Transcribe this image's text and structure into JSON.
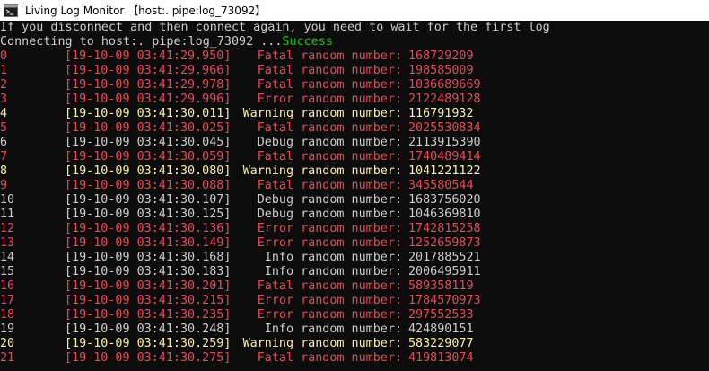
{
  "window": {
    "title": "Living Log Monitor  【host:. pipe:log_73092】"
  },
  "console": {
    "notice": "If you disconnect and then connect again, you need to wait for the first log",
    "connecting": "Connecting to host:. pipe:log_73092 ...",
    "success": "Success"
  },
  "colors": {
    "fatal": "#e74856",
    "error": "#e74856",
    "warning": "#f9f1a5",
    "debug": "#cccccc",
    "info": "#cccccc",
    "success": "#16c60c",
    "background": "#0c0c0c"
  },
  "logs": [
    {
      "index": "0",
      "time": "[19-10-09 03:41:29.950]",
      "level": "Fatal",
      "text": "Fatal random number:",
      "number": "168729209"
    },
    {
      "index": "1",
      "time": "[19-10-09 03:41:29.966]",
      "level": "Fatal",
      "text": "Fatal random number:",
      "number": "198585009"
    },
    {
      "index": "2",
      "time": "[19-10-09 03:41:29.978]",
      "level": "Fatal",
      "text": "Fatal random number:",
      "number": "1036689669"
    },
    {
      "index": "3",
      "time": "[19-10-09 03:41:29.996]",
      "level": "Error",
      "text": "Error random number:",
      "number": "2122489128"
    },
    {
      "index": "4",
      "time": "[19-10-09 03:41:30.011]",
      "level": "Warning",
      "text": "Warning random number:",
      "number": "116791932"
    },
    {
      "index": "5",
      "time": "[19-10-09 03:41:30.025]",
      "level": "Fatal",
      "text": "Fatal random number:",
      "number": "2025530834"
    },
    {
      "index": "6",
      "time": "[19-10-09 03:41:30.045]",
      "level": "Debug",
      "text": "Debug random number:",
      "number": "2113915390"
    },
    {
      "index": "7",
      "time": "[19-10-09 03:41:30.059]",
      "level": "Fatal",
      "text": "Fatal random number:",
      "number": "1740489414"
    },
    {
      "index": "8",
      "time": "[19-10-09 03:41:30.080]",
      "level": "Warning",
      "text": "Warning random number:",
      "number": "1041221122"
    },
    {
      "index": "9",
      "time": "[19-10-09 03:41:30.088]",
      "level": "Fatal",
      "text": "Fatal random number:",
      "number": "345580544"
    },
    {
      "index": "10",
      "time": "[19-10-09 03:41:30.107]",
      "level": "Debug",
      "text": "Debug random number:",
      "number": "1683756020"
    },
    {
      "index": "11",
      "time": "[19-10-09 03:41:30.125]",
      "level": "Debug",
      "text": "Debug random number:",
      "number": "1046369810"
    },
    {
      "index": "12",
      "time": "[19-10-09 03:41:30.136]",
      "level": "Error",
      "text": "Error random number:",
      "number": "1742815258"
    },
    {
      "index": "13",
      "time": "[19-10-09 03:41:30.149]",
      "level": "Error",
      "text": "Error random number:",
      "number": "1252659873"
    },
    {
      "index": "14",
      "time": "[19-10-09 03:41:30.168]",
      "level": "Info",
      "text": "Info random number:",
      "number": "2017885521"
    },
    {
      "index": "15",
      "time": "[19-10-09 03:41:30.183]",
      "level": "Info",
      "text": "Info random number:",
      "number": "2006495911"
    },
    {
      "index": "16",
      "time": "[19-10-09 03:41:30.201]",
      "level": "Fatal",
      "text": "Fatal random number:",
      "number": "589358119"
    },
    {
      "index": "17",
      "time": "[19-10-09 03:41:30.215]",
      "level": "Error",
      "text": "Error random number:",
      "number": "1784570973"
    },
    {
      "index": "18",
      "time": "[19-10-09 03:41:30.235]",
      "level": "Error",
      "text": "Error random number:",
      "number": "297552533"
    },
    {
      "index": "19",
      "time": "[19-10-09 03:41:30.248]",
      "level": "Info",
      "text": "Info random number:",
      "number": "424890151"
    },
    {
      "index": "20",
      "time": "[19-10-09 03:41:30.259]",
      "level": "Warning",
      "text": "Warning random number:",
      "number": "583229077"
    },
    {
      "index": "21",
      "time": "[19-10-09 03:41:30.275]",
      "level": "Fatal",
      "text": "Fatal random number:",
      "number": "419813074"
    }
  ]
}
